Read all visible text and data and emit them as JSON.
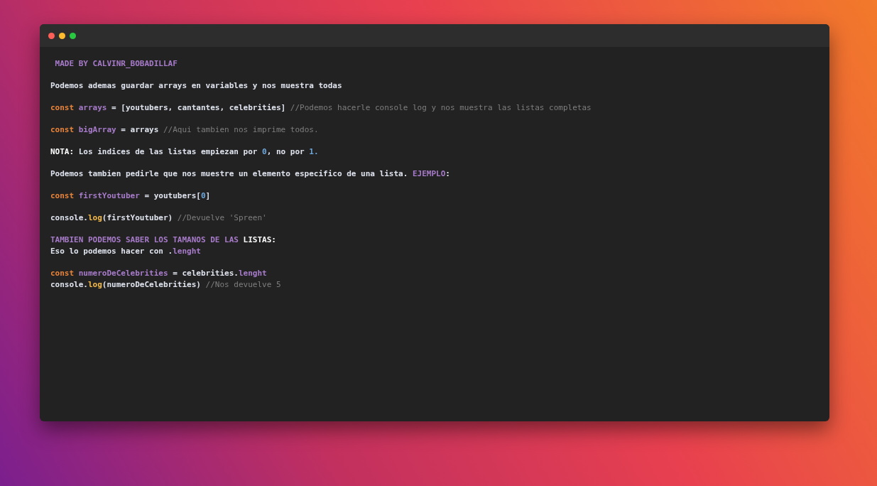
{
  "window": {
    "controls": [
      {
        "kind": "close"
      },
      {
        "kind": "minimize"
      },
      {
        "kind": "maximize"
      }
    ]
  },
  "blocks": [
    {
      "lines": [
        [
          {
            "kind": "variable",
            "text": " MADE BY CALVINR_BOBADILLAF"
          }
        ]
      ]
    },
    {
      "lines": [
        [
          {
            "kind": "plain",
            "text": "Podemos ademas guardar arrays en variables y nos muestra todas"
          }
        ]
      ]
    },
    {
      "lines": [
        [
          {
            "kind": "keyword",
            "text": "const "
          },
          {
            "kind": "variable",
            "text": "arrays"
          },
          {
            "kind": "plain",
            "text": " = [youtubers, cantantes, celebrities] "
          },
          {
            "kind": "comment",
            "text": "//Podemos hacerle console log y nos muestra las listas completas"
          }
        ]
      ]
    },
    {
      "lines": [
        [
          {
            "kind": "keyword",
            "text": "const "
          },
          {
            "kind": "variable",
            "text": "bigArray"
          },
          {
            "kind": "plain",
            "text": " = arrays "
          },
          {
            "kind": "comment",
            "text": "//Aqui tambien nos imprime todos."
          }
        ]
      ]
    },
    {
      "lines": [
        [
          {
            "kind": "strong",
            "text": "NOTA:"
          },
          {
            "kind": "plain",
            "text": " Los indices de las listas empiezan por "
          },
          {
            "kind": "number",
            "text": "0"
          },
          {
            "kind": "plain",
            "text": ", no por "
          },
          {
            "kind": "number",
            "text": "1."
          }
        ]
      ]
    },
    {
      "lines": [
        [
          {
            "kind": "plain",
            "text": "Podemos tambien pedirle que nos muestre un elemento especifico de una lista. "
          },
          {
            "kind": "variable",
            "text": "EJEMPLO"
          },
          {
            "kind": "plain",
            "text": ":"
          }
        ]
      ]
    },
    {
      "lines": [
        [
          {
            "kind": "keyword",
            "text": "const "
          },
          {
            "kind": "variable",
            "text": "firstYoutuber"
          },
          {
            "kind": "plain",
            "text": " = youtubers["
          },
          {
            "kind": "number",
            "text": "0"
          },
          {
            "kind": "plain",
            "text": "]"
          }
        ]
      ]
    },
    {
      "lines": [
        [
          {
            "kind": "plain",
            "text": "console."
          },
          {
            "kind": "function",
            "text": "log"
          },
          {
            "kind": "plain",
            "text": "(firstYoutuber) "
          },
          {
            "kind": "comment",
            "text": "//Devuelve 'Spreen'"
          }
        ]
      ]
    },
    {
      "lines": [
        [
          {
            "kind": "variable",
            "text": "TAMBIEN PODEMOS SABER LOS TAMANOS DE LAS "
          },
          {
            "kind": "strong",
            "text": "LISTAS:"
          }
        ],
        [
          {
            "kind": "plain",
            "text": "Eso lo podemos hacer con ."
          },
          {
            "kind": "variable",
            "text": "lenght"
          }
        ]
      ]
    },
    {
      "lines": [
        [
          {
            "kind": "keyword",
            "text": "const "
          },
          {
            "kind": "variable",
            "text": "numeroDeCelebrities"
          },
          {
            "kind": "plain",
            "text": " = celebrities."
          },
          {
            "kind": "variable",
            "text": "lenght"
          }
        ],
        [
          {
            "kind": "plain",
            "text": "console."
          },
          {
            "kind": "function",
            "text": "log"
          },
          {
            "kind": "plain",
            "text": "(numeroDeCelebrities) "
          },
          {
            "kind": "comment",
            "text": "//Nos devuelve 5"
          }
        ]
      ]
    }
  ]
}
